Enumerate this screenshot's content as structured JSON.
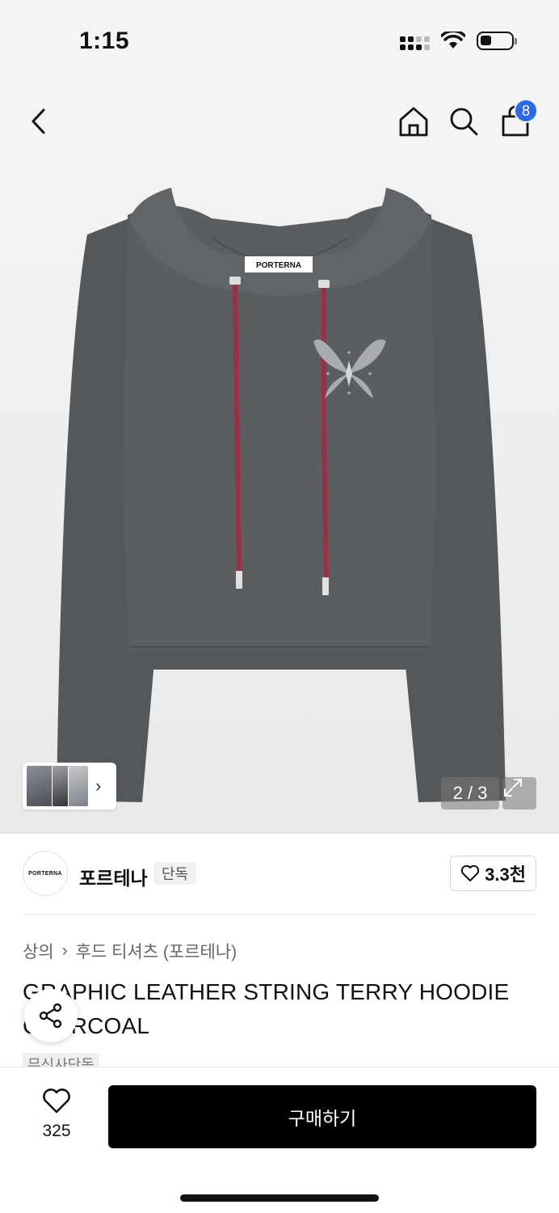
{
  "status": {
    "time": "1:15"
  },
  "nav": {
    "cart_count": "8",
    "icons": [
      "chevron-left-icon",
      "home-icon",
      "search-icon",
      "shopping-bag-icon"
    ]
  },
  "product_image": {
    "label_text": "PORTERNA",
    "counter": "2 / 3",
    "thumbnail_arrow": "›"
  },
  "brand": {
    "logo_text": "PORTERNA",
    "name": "포르테나",
    "badge": "단독",
    "likes": "3.3천"
  },
  "breadcrumb": {
    "category": "상의",
    "separator": "›",
    "subcategory": "후드 티셔츠 (포르테나)"
  },
  "product": {
    "title": "GRAPHIC LEATHER STRING TERRY HOODIE CHARCOAL",
    "tag": "무신사단독"
  },
  "bottom_bar": {
    "wish_count": "325",
    "buy_label": "구매하기"
  },
  "colors": {
    "accent_badge": "#2d6ae8",
    "buy_button": "#000000",
    "garment": "#5a5d60",
    "string": "#9b2f45"
  }
}
